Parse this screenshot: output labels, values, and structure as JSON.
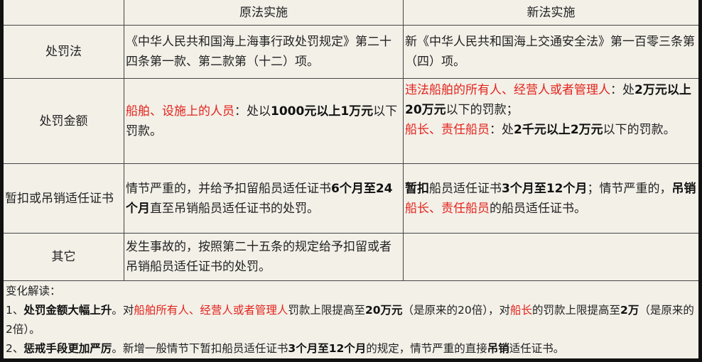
{
  "header": {
    "col1": "",
    "col2": "原法实施",
    "col3": "新法实施"
  },
  "rows": [
    {
      "label": "处罚法",
      "old": "《中华人民共和国海上海事行政处罚规定》第二十四条第一款、第二款第（十二）项。",
      "new": "新《中华人民共和国海上交通安全法》第一百零三条第（四）项。"
    },
    {
      "label": "处罚金额",
      "old_parts": [
        "船舶、设施上的人员",
        "：处以",
        "1000元以上1万元",
        "以下罚款。"
      ],
      "new_line1_parts": [
        "违法船舶的所有人、经营人或者管理人",
        "：处",
        "2万元以上20万元",
        "以下的罚款；"
      ],
      "new_line2_parts": [
        "船长、责任船员",
        "：处",
        "2千元以上2万元",
        "以下的罚款。"
      ]
    },
    {
      "label": "暂扣或吊销适任证书",
      "old_parts": [
        "情节严重的，并给予扣留船员适任证书",
        "6个月至24个月",
        "直至吊销船员适任证书的处罚。"
      ],
      "new_parts": [
        "暂扣",
        "船员适任证书",
        "3个月至12个月",
        "；情节严重的，",
        "吊销",
        "船长、责任船员",
        "的船员适任证书。"
      ]
    },
    {
      "label": "其它",
      "old": "发生事故的，按照第二十五条的规定给予扣留或者吊销船员适任证书的处罚。",
      "new": ""
    }
  ],
  "notes": {
    "title": "变化解读：",
    "item1_parts": [
      "1、",
      "处罚金额大幅上升",
      "。对",
      "船舶所有人、经营人或者管理人",
      "罚款上限提高至",
      "20万元",
      "（是原来的20倍），对",
      "船长",
      "的罚款上限提高至",
      "2万",
      "（是原来的2倍）。"
    ],
    "item2_parts": [
      "2、",
      "惩戒手段更加严厉",
      "。新增一般情节下暂扣船员适任证书",
      "3个月至12个月",
      "的规定，情节严重的直接",
      "吊销",
      "适任证书。"
    ]
  }
}
